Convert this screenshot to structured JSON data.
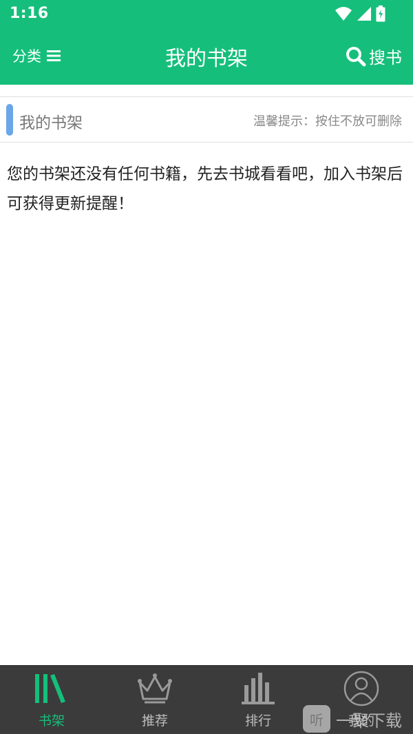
{
  "status_bar": {
    "time": "1:16",
    "icons": [
      "wifi-icon",
      "signal-icon",
      "battery-charging-icon"
    ]
  },
  "header": {
    "category_label": "分类",
    "title": "我的书架",
    "search_label": "搜书"
  },
  "shelf": {
    "title": "我的书架",
    "tip": "温馨提示：按住不放可删除"
  },
  "empty_message": "您的书架还没有任何书籍，先去书城看看吧，加入书架后可获得更新提醒！",
  "bottom_nav": {
    "items": [
      {
        "label": "书架",
        "icon": "bookshelf-icon",
        "active": true
      },
      {
        "label": "推荐",
        "icon": "crown-icon",
        "active": false
      },
      {
        "label": "排行",
        "icon": "bar-chart-icon",
        "active": false
      },
      {
        "label": "我的",
        "icon": "user-icon",
        "active": false
      }
    ]
  },
  "watermark": {
    "badge": "听",
    "text": "一聚下载"
  },
  "colors": {
    "primary": "#15bf7b",
    "accent_bar": "#6aa6e8",
    "nav_background": "#3b3b3b",
    "nav_inactive": "#bdbdbd"
  }
}
